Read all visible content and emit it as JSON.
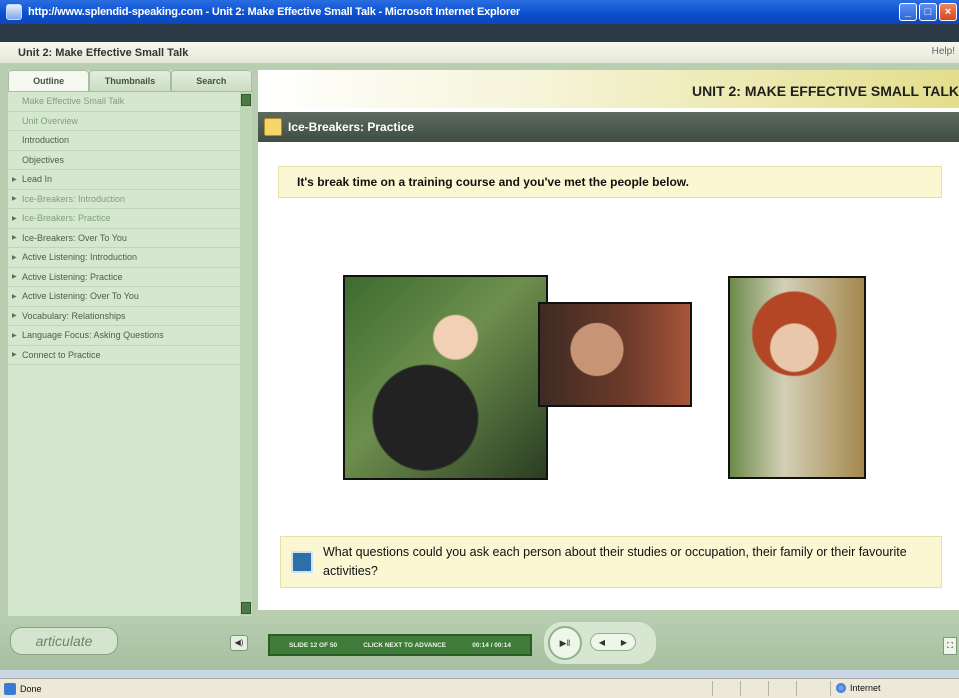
{
  "window": {
    "title": "http://www.splendid-speaking.com - Unit 2: Make Effective Small Talk - Microsoft Internet Explorer",
    "controls": [
      "_",
      "□",
      "×"
    ]
  },
  "course": {
    "title": "Unit 2: Make Effective Small Talk",
    "help": "Help!"
  },
  "sidebar": {
    "tabs": [
      "Outline",
      "Thumbnails",
      "Search"
    ],
    "items": [
      {
        "label": "Make Effective Small Talk",
        "arrow": "",
        "dim": true
      },
      {
        "label": "Unit Overview",
        "arrow": "",
        "dim": true
      },
      {
        "label": "Introduction",
        "arrow": "",
        "dim": false
      },
      {
        "label": "Objectives",
        "arrow": "",
        "dim": false
      },
      {
        "label": "Lead In",
        "arrow": "▶",
        "dim": false
      },
      {
        "label": "Ice-Breakers: Introduction",
        "arrow": "▶",
        "dim": true
      },
      {
        "label": "Ice-Breakers: Practice",
        "arrow": "▶",
        "dim": true
      },
      {
        "label": "Ice-Breakers: Over To You",
        "arrow": "▶",
        "dim": false
      },
      {
        "label": "Active Listening: Introduction",
        "arrow": "▶",
        "dim": false
      },
      {
        "label": "Active Listening: Practice",
        "arrow": "▶",
        "dim": false
      },
      {
        "label": "Active Listening: Over To You",
        "arrow": "▶",
        "dim": false
      },
      {
        "label": "Vocabulary: Relationships",
        "arrow": "▶",
        "dim": false
      },
      {
        "label": "Language Focus: Asking Questions",
        "arrow": "▶",
        "dim": false
      },
      {
        "label": "Connect to Practice",
        "arrow": "▶",
        "dim": false
      }
    ]
  },
  "slide": {
    "unit_title": "UNIT 2: MAKE EFFECTIVE SMALL TALK",
    "section_title": "Ice-Breakers: Practice",
    "prompt": "It's break time on a training course and you've met the people below.",
    "question": "What questions could you ask each person about their studies or occupation, their family or their favourite activities?"
  },
  "player": {
    "logo": "articulate",
    "progress_left": "SLIDE 12 OF 50",
    "progress_mid": "CLICK NEXT TO ADVANCE",
    "progress_right": "00:14 / 00:14",
    "play_icon": "▶‖",
    "prev_icon": "◀",
    "next_icon": "▶",
    "volume_icon": "◀)"
  },
  "status": {
    "left": "Done",
    "zone": "Internet"
  }
}
